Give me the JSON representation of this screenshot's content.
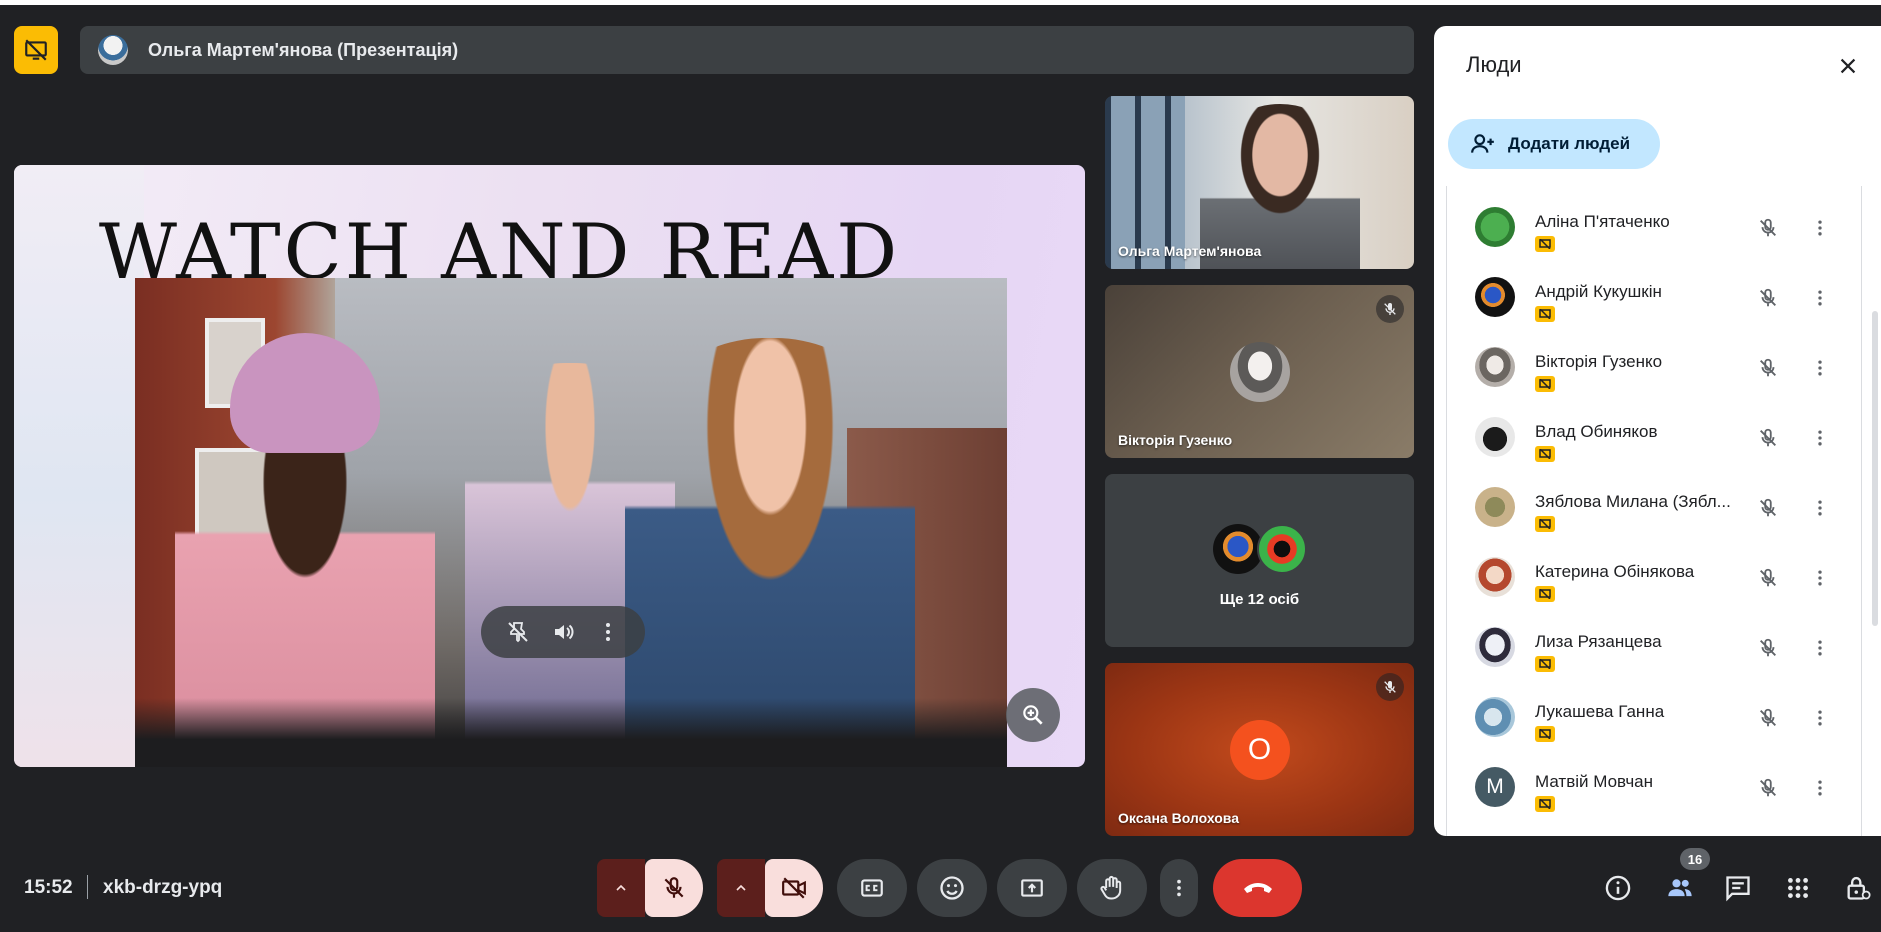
{
  "presenter": {
    "name": "Ольга Мартем'янова (Презентація)"
  },
  "presentation": {
    "slide_title": "WATCH AND READ"
  },
  "tiles": [
    {
      "name": "Ольга Мартем'янова"
    },
    {
      "name": "Вікторія Гузенко"
    },
    {
      "more_label": "Ще 12 осіб"
    },
    {
      "name": "Оксана Волохова",
      "initial": "О"
    }
  ],
  "people_panel": {
    "title": "Люди",
    "add_people_label": "Додати людей",
    "people": [
      {
        "name": "Аліна П'ятаченко"
      },
      {
        "name": "Андрій Кукушкін"
      },
      {
        "name": "Вікторія Гузенко"
      },
      {
        "name": "Влад Обиняков"
      },
      {
        "name": "Зяблова Милана (Зябл..."
      },
      {
        "name": "Катерина Обінякова"
      },
      {
        "name": "Лиза Рязанцева"
      },
      {
        "name": "Лукашева Ганна"
      },
      {
        "name": "Матвій Мовчан",
        "initial": "М"
      }
    ]
  },
  "bottom_bar": {
    "time": "15:52",
    "meeting_code": "xkb-drzg-ypq",
    "people_count": "16"
  },
  "colors": {
    "present_yellow": "#fbbc04",
    "end_call_red": "#dc362e",
    "muted_pink": "#f9dedc",
    "add_people_blue": "#c2e7ff"
  }
}
